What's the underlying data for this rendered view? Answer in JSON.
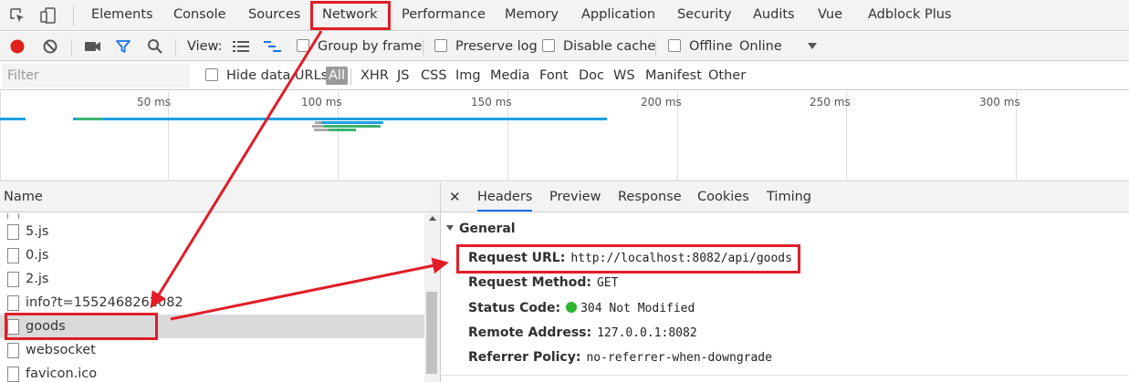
{
  "tabs": {
    "items": [
      "Elements",
      "Console",
      "Sources",
      "Network",
      "Performance",
      "Memory",
      "Application",
      "Security",
      "Audits",
      "Vue",
      "Adblock Plus"
    ],
    "active": "Network"
  },
  "toolbar": {
    "view_label": "View:",
    "group_by_frame": "Group by frame",
    "preserve_log": "Preserve log",
    "disable_cache": "Disable cache",
    "offline": "Offline",
    "throttling": "Online"
  },
  "filter": {
    "placeholder": "Filter",
    "hide_data_urls": "Hide data URLs",
    "types": [
      "All",
      "XHR",
      "JS",
      "CSS",
      "Img",
      "Media",
      "Font",
      "Doc",
      "WS",
      "Manifest",
      "Other"
    ],
    "active_type": "All"
  },
  "overview": {
    "ticks": [
      "50 ms",
      "100 ms",
      "150 ms",
      "200 ms",
      "250 ms",
      "300 ms"
    ]
  },
  "requests": {
    "header": "Name",
    "rows": [
      "5.js",
      "0.js",
      "2.js",
      "info?t=1552468262082",
      "goods",
      "websocket",
      "favicon.ico"
    ],
    "selected": "goods"
  },
  "details": {
    "tabs": [
      "Headers",
      "Preview",
      "Response",
      "Cookies",
      "Timing"
    ],
    "active_tab": "Headers",
    "general_title": "General",
    "fields": [
      {
        "key": "Request URL:",
        "value": "http://localhost:8082/api/goods"
      },
      {
        "key": "Request Method:",
        "value": "GET"
      },
      {
        "key": "Status Code:",
        "value": "304 Not Modified"
      },
      {
        "key": "Remote Address:",
        "value": "127.0.0.1:8082"
      },
      {
        "key": "Referrer Policy:",
        "value": "no-referrer-when-downgrade"
      }
    ]
  },
  "colors": {
    "record": "#e0201b",
    "accent": "#1a73e8",
    "annotation": "#e11d28",
    "status_ok": "#2fb52f"
  }
}
